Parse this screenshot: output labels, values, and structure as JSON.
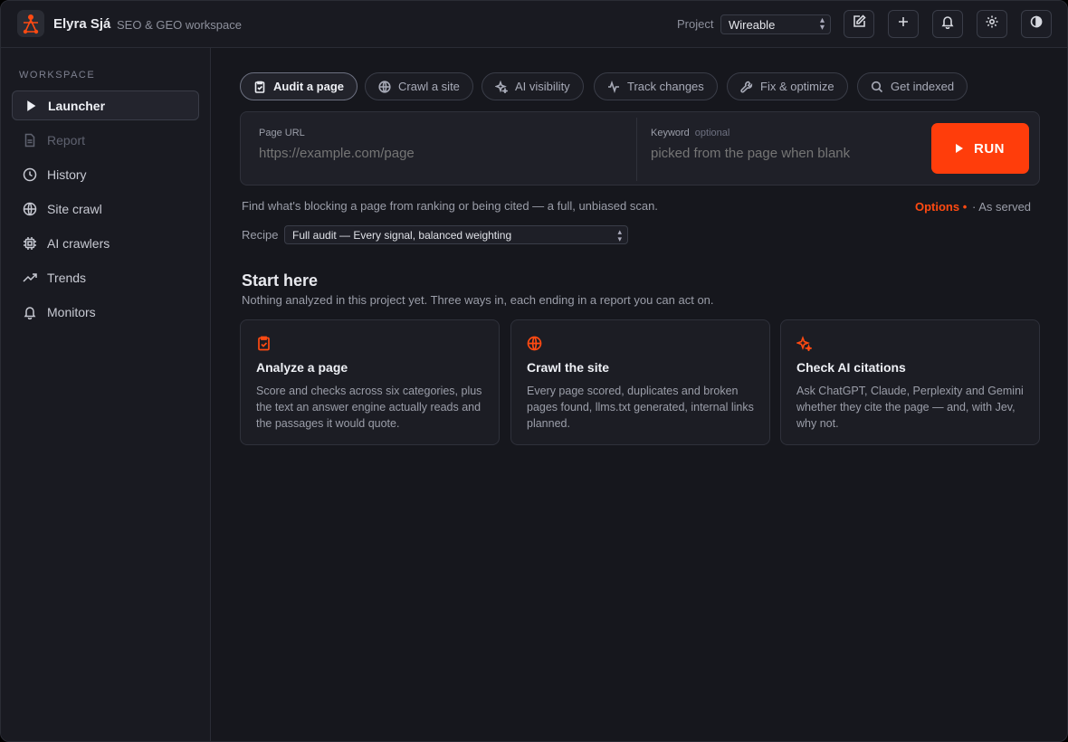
{
  "header": {
    "brand_name": "Elyra Sjá",
    "brand_sub": "SEO & GEO workspace",
    "project_label": "Project",
    "project_value": "Wireable",
    "buttons": [
      "edit-icon",
      "plus-icon",
      "bell-icon",
      "gear-icon",
      "contrast-icon"
    ]
  },
  "sidebar": {
    "section_title": "WORKSPACE",
    "items": [
      {
        "label": "Launcher",
        "icon": "play-icon",
        "state": "active"
      },
      {
        "label": "Report",
        "icon": "document-icon",
        "state": "disabled"
      },
      {
        "label": "History",
        "icon": "clock-icon",
        "state": "normal"
      },
      {
        "label": "Site crawl",
        "icon": "globe-icon",
        "state": "normal"
      },
      {
        "label": "AI crawlers",
        "icon": "chip-icon",
        "state": "normal"
      },
      {
        "label": "Trends",
        "icon": "trend-icon",
        "state": "normal"
      },
      {
        "label": "Monitors",
        "icon": "bell-icon",
        "state": "normal"
      }
    ]
  },
  "tabs": [
    {
      "label": "Audit a page",
      "icon": "clipboard-check-icon",
      "active": true
    },
    {
      "label": "Crawl a site",
      "icon": "globe-icon",
      "active": false
    },
    {
      "label": "AI visibility",
      "icon": "sparkle-icon",
      "active": false
    },
    {
      "label": "Track changes",
      "icon": "pulse-icon",
      "active": false
    },
    {
      "label": "Fix & optimize",
      "icon": "wrench-icon",
      "active": false
    },
    {
      "label": "Get indexed",
      "icon": "search-icon",
      "active": false
    }
  ],
  "form": {
    "url_label": "Page URL",
    "url_placeholder": "https://example.com/page",
    "keyword_label": "Keyword",
    "keyword_optional": "optional",
    "keyword_placeholder": "picked from the page when blank",
    "run_label": "RUN",
    "description": "Find what's blocking a page from ranking or being cited — a full, unbiased scan.",
    "options_label": "Options •",
    "served_label": "· As served",
    "recipe_label": "Recipe",
    "recipe_value": "Full audit — Every signal, balanced weighting"
  },
  "start": {
    "title": "Start here",
    "subtitle": "Nothing analyzed in this project yet. Three ways in, each ending in a report you can act on.",
    "cards": [
      {
        "title": "Analyze a page",
        "icon": "clipboard-check-icon",
        "body": "Score and checks across six categories, plus the text an answer engine actually reads and the passages it would quote."
      },
      {
        "title": "Crawl the site",
        "icon": "globe-icon",
        "body": "Every page scored, duplicates and broken pages found, llms.txt generated, internal links planned."
      },
      {
        "title": "Check AI citations",
        "icon": "sparkle-icon",
        "body": "Ask ChatGPT, Claude, Perplexity and Gemini whether they cite the page — and, with Jev, why not."
      }
    ]
  },
  "colors": {
    "accent": "#ff3d0b",
    "background": "#16171d",
    "panel": "#1f2028"
  }
}
